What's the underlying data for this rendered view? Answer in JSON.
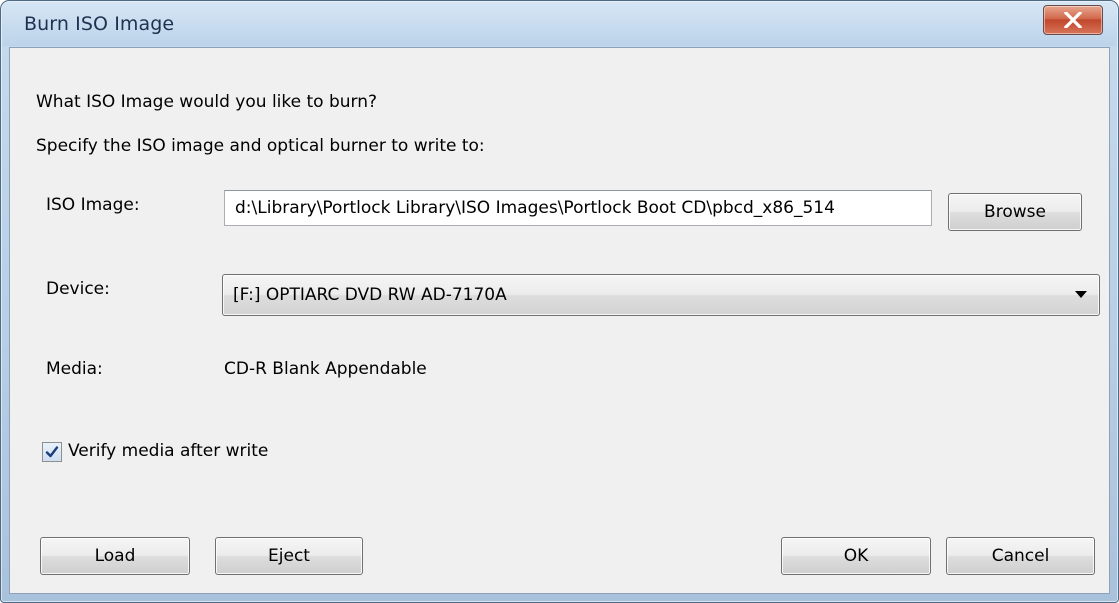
{
  "window": {
    "title": "Burn ISO Image",
    "close_icon": "close-x-icon"
  },
  "prompt": {
    "question": "What ISO Image would you like to burn?",
    "instruction": "Specify the ISO image and optical burner to write to:"
  },
  "iso_image": {
    "label": "ISO Image:",
    "value": "d:\\Library\\Portlock Library\\ISO Images\\Portlock Boot CD\\pbcd_x86_514",
    "browse_label": "Browse"
  },
  "device": {
    "label": "Device:",
    "selected": "[F:] OPTIARC  DVD RW AD-7170A",
    "dropdown_icon": "chevron-down-icon"
  },
  "media": {
    "label": "Media:",
    "value": "CD-R Blank Appendable"
  },
  "verify": {
    "label": "Verify media after write",
    "checked": true
  },
  "buttons": {
    "load": "Load",
    "eject": "Eject",
    "ok": "OK",
    "cancel": "Cancel"
  },
  "colors": {
    "title_text": "#1e3250",
    "close_button": "#c0472c",
    "client_bg": "#f0f0f0",
    "check_mark": "#1d3e7a"
  }
}
